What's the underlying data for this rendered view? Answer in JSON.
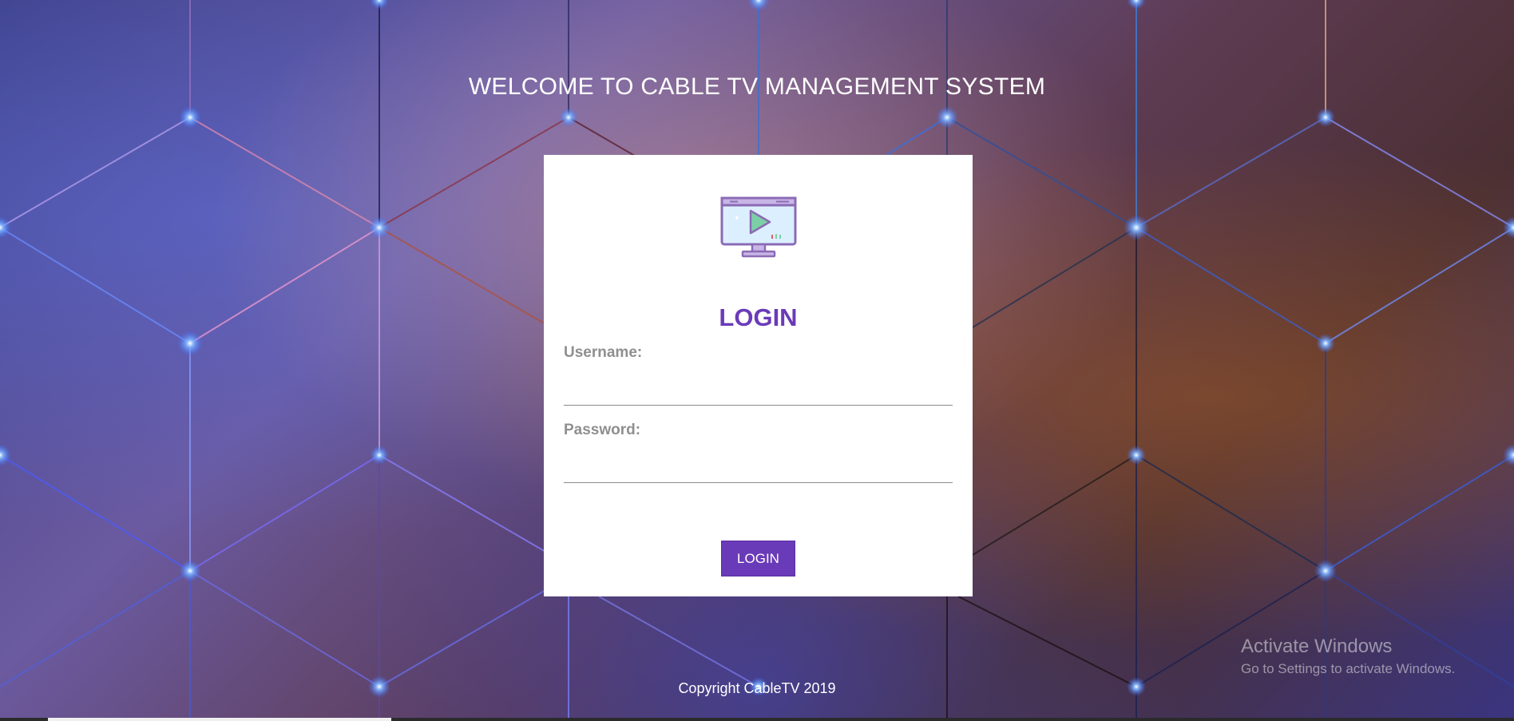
{
  "header": {
    "welcome_text": "WELCOME TO CABLE TV MANAGEMENT SYSTEM"
  },
  "login_card": {
    "icon": "tv-monitor-play-icon",
    "title": "LOGIN",
    "username_label": "Username:",
    "username_value": "",
    "password_label": "Password:",
    "password_value": "",
    "button_label": "LOGIN"
  },
  "footer": {
    "copyright": "Copyright CableTV 2019"
  },
  "watermark": {
    "line1": "Activate Windows",
    "line2": "Go to Settings to activate Windows."
  },
  "colors": {
    "accent": "#6a3bb8",
    "card_bg": "#ffffff",
    "label_gray": "#8f8f8f"
  }
}
